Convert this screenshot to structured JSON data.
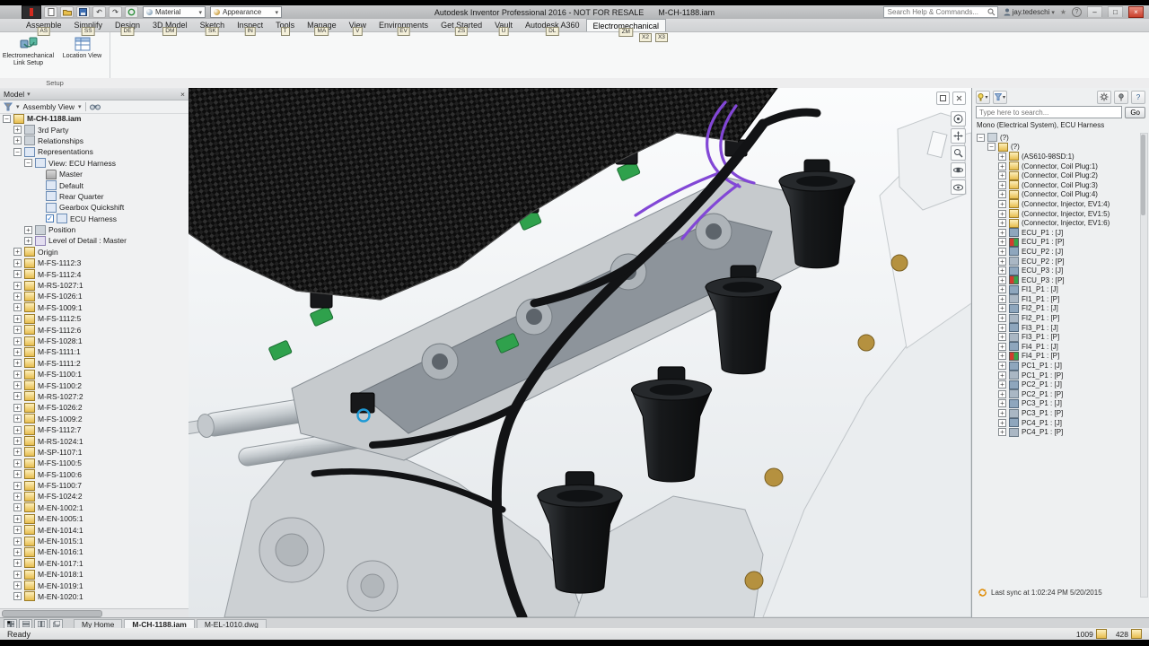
{
  "colors": {
    "accent_blue": "#2f7fc1",
    "connector_green": "#2fa14c",
    "wire_purple": "#8247d6",
    "harness_black": "#121315",
    "carbon_black": "#0c0c0c",
    "brass": "#b5913f"
  },
  "icons": {
    "chevron_down": "▾",
    "plus": "+",
    "minus": "−",
    "check": "✓",
    "close": "×",
    "minimize": "–",
    "maximize": "□",
    "star": "★",
    "help": "?"
  },
  "titlebar": {
    "app_title": "Autodesk Inventor Professional 2016 - NOT FOR RESALE",
    "doc_title": "M-CH-1188.iam",
    "search_placeholder": "Search Help & Commands...",
    "user": "jay.tedeschi",
    "material": "Material",
    "appearance": "Appearance"
  },
  "ribbon": {
    "tabs": [
      {
        "label": "Assemble",
        "keytip": "AS"
      },
      {
        "label": "Simplify",
        "keytip": "SS"
      },
      {
        "label": "Design",
        "keytip": "DE"
      },
      {
        "label": "3D Model",
        "keytip": "DM"
      },
      {
        "label": "Sketch",
        "keytip": "SK"
      },
      {
        "label": "Inspect",
        "keytip": "IN"
      },
      {
        "label": "Tools",
        "keytip": "T"
      },
      {
        "label": "Manage",
        "keytip": "MA"
      },
      {
        "label": "View",
        "keytip": "V"
      },
      {
        "label": "Environments",
        "keytip": "EV"
      },
      {
        "label": "Get Started",
        "keytip": "ZS"
      },
      {
        "label": "Vault",
        "keytip": "U"
      },
      {
        "label": "Autodesk A360",
        "keytip": "DL"
      },
      {
        "label": "Electromechanical",
        "keytip": "ZM"
      }
    ],
    "extra_keytips": [
      "X2",
      "X3"
    ],
    "active_tab": "Electromechanical",
    "buttons": [
      {
        "label": "Electromechanical Link Setup"
      },
      {
        "label": "Location View"
      }
    ],
    "panel_label": "Setup"
  },
  "browser": {
    "title": "Model",
    "view_selector": "Assembly View",
    "tree": [
      {
        "l": "M-CH-1188.iam",
        "d": 0,
        "e": "-",
        "i": "asm"
      },
      {
        "l": "3rd Party",
        "d": 1,
        "e": "+",
        "i": "third"
      },
      {
        "l": "Relationships",
        "d": 1,
        "e": "+",
        "i": "rel"
      },
      {
        "l": "Representations",
        "d": 1,
        "e": "-",
        "i": "rep"
      },
      {
        "l": "View: ECU Harness",
        "d": 2,
        "e": "-",
        "i": "view"
      },
      {
        "l": "Master",
        "d": 3,
        "e": "",
        "i": "lock"
      },
      {
        "l": "Default",
        "d": 3,
        "e": "",
        "i": "view2"
      },
      {
        "l": "Rear Quarter",
        "d": 3,
        "e": "",
        "i": "view2"
      },
      {
        "l": "Gearbox Quickshift",
        "d": 3,
        "e": "",
        "i": "view2"
      },
      {
        "l": "ECU Harness",
        "d": 3,
        "e": "",
        "i": "view2",
        "c": true
      },
      {
        "l": "Position",
        "d": 2,
        "e": "+",
        "i": "pos"
      },
      {
        "l": "Level of Detail : Master",
        "d": 2,
        "e": "+",
        "i": "lod"
      },
      {
        "l": "Origin",
        "d": 1,
        "e": "+",
        "i": "origin"
      },
      {
        "l": "M-FS-1112:3",
        "d": 1,
        "e": "+",
        "i": "part"
      },
      {
        "l": "M-FS-1112:4",
        "d": 1,
        "e": "+",
        "i": "part"
      },
      {
        "l": "M-RS-1027:1",
        "d": 1,
        "e": "+",
        "i": "part"
      },
      {
        "l": "M-FS-1026:1",
        "d": 1,
        "e": "+",
        "i": "part"
      },
      {
        "l": "M-FS-1009:1",
        "d": 1,
        "e": "+",
        "i": "part"
      },
      {
        "l": "M-FS-1112:5",
        "d": 1,
        "e": "+",
        "i": "part"
      },
      {
        "l": "M-FS-1112:6",
        "d": 1,
        "e": "+",
        "i": "part"
      },
      {
        "l": "M-FS-1028:1",
        "d": 1,
        "e": "+",
        "i": "part"
      },
      {
        "l": "M-FS-1111:1",
        "d": 1,
        "e": "+",
        "i": "part"
      },
      {
        "l": "M-FS-1111:2",
        "d": 1,
        "e": "+",
        "i": "part"
      },
      {
        "l": "M-FS-1100:1",
        "d": 1,
        "e": "+",
        "i": "part"
      },
      {
        "l": "M-FS-1100:2",
        "d": 1,
        "e": "+",
        "i": "part"
      },
      {
        "l": "M-RS-1027:2",
        "d": 1,
        "e": "+",
        "i": "part"
      },
      {
        "l": "M-FS-1026:2",
        "d": 1,
        "e": "+",
        "i": "part"
      },
      {
        "l": "M-FS-1009:2",
        "d": 1,
        "e": "+",
        "i": "part"
      },
      {
        "l": "M-FS-1112:7",
        "d": 1,
        "e": "+",
        "i": "part"
      },
      {
        "l": "M-RS-1024:1",
        "d": 1,
        "e": "+",
        "i": "part"
      },
      {
        "l": "M-SP-1107:1",
        "d": 1,
        "e": "+",
        "i": "part"
      },
      {
        "l": "M-FS-1100:5",
        "d": 1,
        "e": "+",
        "i": "part"
      },
      {
        "l": "M-FS-1100:6",
        "d": 1,
        "e": "+",
        "i": "part"
      },
      {
        "l": "M-FS-1100:7",
        "d": 1,
        "e": "+",
        "i": "part"
      },
      {
        "l": "M-FS-1024:2",
        "d": 1,
        "e": "+",
        "i": "part"
      },
      {
        "l": "M-EN-1002:1",
        "d": 1,
        "e": "+",
        "i": "part"
      },
      {
        "l": "M-EN-1005:1",
        "d": 1,
        "e": "+",
        "i": "part"
      },
      {
        "l": "M-EN-1014:1",
        "d": 1,
        "e": "+",
        "i": "part"
      },
      {
        "l": "M-EN-1015:1",
        "d": 1,
        "e": "+",
        "i": "part"
      },
      {
        "l": "M-EN-1016:1",
        "d": 1,
        "e": "+",
        "i": "part"
      },
      {
        "l": "M-EN-1017:1",
        "d": 1,
        "e": "+",
        "i": "part"
      },
      {
        "l": "M-EN-1018:1",
        "d": 1,
        "e": "+",
        "i": "part"
      },
      {
        "l": "M-EN-1019:1",
        "d": 1,
        "e": "+",
        "i": "part"
      },
      {
        "l": "M-EN-1020:1",
        "d": 1,
        "e": "+",
        "i": "part"
      }
    ]
  },
  "em_panel": {
    "search_placeholder": "Type here to search...",
    "go_label": "Go",
    "subtitle": "Mono (Electrical System), ECU Harness",
    "sync_text": "Last sync at 1:02:24 PM 5/20/2015",
    "tree": [
      {
        "l": "(?)",
        "d": 0,
        "e": "-",
        "i": "emroot"
      },
      {
        "l": "(?)",
        "d": 1,
        "e": "-",
        "i": "emfolder"
      },
      {
        "l": "(AS610-98SD:1)",
        "d": 2,
        "e": "+",
        "i": "emfolder"
      },
      {
        "l": "(Connector, Coil Plug:1)",
        "d": 2,
        "e": "+",
        "i": "emfolder"
      },
      {
        "l": "(Connector, Coil Plug:2)",
        "d": 2,
        "e": "+",
        "i": "emfolder"
      },
      {
        "l": "(Connector, Coil Plug:3)",
        "d": 2,
        "e": "+",
        "i": "emfolder"
      },
      {
        "l": "(Connector, Coil Plug:4)",
        "d": 2,
        "e": "+",
        "i": "emfolder"
      },
      {
        "l": "(Connector, Injector, EV1:4)",
        "d": 2,
        "e": "+",
        "i": "emfolder"
      },
      {
        "l": "(Connector, Injector, EV1:5)",
        "d": 2,
        "e": "+",
        "i": "emfolder"
      },
      {
        "l": "(Connector, Injector, EV1:6)",
        "d": 2,
        "e": "+",
        "i": "emfolder"
      },
      {
        "l": "ECU_P1 : [J]",
        "d": 2,
        "e": "+",
        "i": "jack"
      },
      {
        "l": "ECU_P1 : [P]",
        "d": 2,
        "e": "+",
        "i": "pair"
      },
      {
        "l": "ECU_P2 : [J]",
        "d": 2,
        "e": "+",
        "i": "jack"
      },
      {
        "l": "ECU_P2 : [P]",
        "d": 2,
        "e": "+",
        "i": "plug"
      },
      {
        "l": "ECU_P3 : [J]",
        "d": 2,
        "e": "+",
        "i": "jack"
      },
      {
        "l": "ECU_P3 : [P]",
        "d": 2,
        "e": "+",
        "i": "pair"
      },
      {
        "l": "FI1_P1 : [J]",
        "d": 2,
        "e": "+",
        "i": "jack"
      },
      {
        "l": "FI1_P1 : [P]",
        "d": 2,
        "e": "+",
        "i": "plug"
      },
      {
        "l": "FI2_P1 : [J]",
        "d": 2,
        "e": "+",
        "i": "jack"
      },
      {
        "l": "FI2_P1 : [P]",
        "d": 2,
        "e": "+",
        "i": "plug"
      },
      {
        "l": "FI3_P1 : [J]",
        "d": 2,
        "e": "+",
        "i": "jack"
      },
      {
        "l": "FI3_P1 : [P]",
        "d": 2,
        "e": "+",
        "i": "plug"
      },
      {
        "l": "FI4_P1 : [J]",
        "d": 2,
        "e": "+",
        "i": "jack"
      },
      {
        "l": "FI4_P1 : [P]",
        "d": 2,
        "e": "+",
        "i": "pair"
      },
      {
        "l": "PC1_P1 : [J]",
        "d": 2,
        "e": "+",
        "i": "jack"
      },
      {
        "l": "PC1_P1 : [P]",
        "d": 2,
        "e": "+",
        "i": "plug"
      },
      {
        "l": "PC2_P1 : [J]",
        "d": 2,
        "e": "+",
        "i": "jack"
      },
      {
        "l": "PC2_P1 : [P]",
        "d": 2,
        "e": "+",
        "i": "plug"
      },
      {
        "l": "PC3_P1 : [J]",
        "d": 2,
        "e": "+",
        "i": "jack"
      },
      {
        "l": "PC3_P1 : [P]",
        "d": 2,
        "e": "+",
        "i": "plug"
      },
      {
        "l": "PC4_P1 : [J]",
        "d": 2,
        "e": "+",
        "i": "jack"
      },
      {
        "l": "PC4_P1 : [P]",
        "d": 2,
        "e": "+",
        "i": "plug"
      }
    ]
  },
  "doc_tabs": {
    "tabs": [
      "My Home",
      "M-CH-1188.iam",
      "M-EL-1010.dwg"
    ],
    "active": "M-CH-1188.iam"
  },
  "statusbar": {
    "ready": "Ready",
    "count1": "1009",
    "count2": "428"
  }
}
